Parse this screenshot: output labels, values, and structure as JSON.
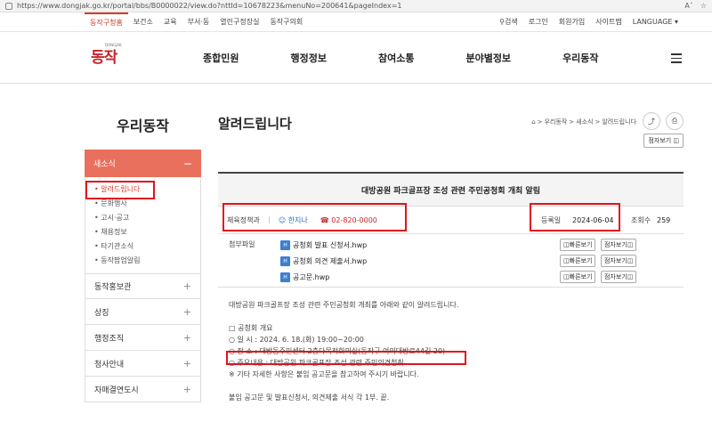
{
  "browser": {
    "url": "https://www.dongjak.go.kr/portal/bbs/B0000022/view.do?nttId=10678223&menuNo=200641&pageIndex=1",
    "read_label": "Aˆ",
    "star": "☆"
  },
  "util": {
    "topnav": [
      "동작구청홈",
      "보건소",
      "교육",
      "부서·동",
      "열린구정장실",
      "동작구의회"
    ],
    "right": [
      "검색",
      "로그인",
      "회원가입",
      "사이트맵",
      "LANGUAGE ▾"
    ]
  },
  "header": {
    "logo_text": "동작",
    "logo_small": "DONGJAK",
    "gnb": [
      "종합민원",
      "행정정보",
      "참여소통",
      "분야별정보",
      "우리동작"
    ]
  },
  "side": {
    "title": "우리동작",
    "current": "새소식",
    "current_icon": "−",
    "sub": [
      "알려드립니다",
      "문화행사",
      "고시·공고",
      "채용정보",
      "타기관소식",
      "동작팝업알림"
    ],
    "groups": [
      "동작홍보관",
      "상징",
      "행정조직",
      "청사안내",
      "자매결연도시"
    ],
    "plus": "+"
  },
  "content": {
    "title": "알려드립니다",
    "crumb": [
      "⌂",
      "우리동작",
      "새소식",
      "알려드립니다"
    ],
    "crumb_sep": ">",
    "share_icon": "⤴",
    "print_icon": "⎙",
    "viewer_label": "점자보기",
    "board": {
      "title": "대방공원 파크골프장 조성 관련 주민공청회 개최 알림",
      "dept": "체육정책과",
      "person": "☺ 한지나",
      "phone": "☎ 02-820-0000",
      "date_label": "등록일",
      "date": "2024-06-04",
      "views_label": "조회수",
      "views": "259",
      "files_label": "첨부파일",
      "files": [
        "공청회 발표 신청서.hwp",
        "공청회 의견 제출서.hwp",
        "공고문.hwp"
      ],
      "quick_label": "빠른보기",
      "braille_label": "점자보기",
      "file_icon": "H"
    },
    "body": [
      "대방공원 파크골프장 조성 관련 주민공청회 개최를 아래와 같이 알려드립니다.",
      "",
      "□ 공청회 개요",
      "○ 일 시 : 2024. 6. 18.(화) 19:00~20:00",
      "○ 장 소 : 대방동주민센터 2층다목적회의실(동작구 여의대방로44길 20)",
      "○ 주요내용 : 대방공원 파크골프장 조성 관련 주민의견청취",
      "※ 기타 자세한 사항은 붙임 공고문을 참고하여 주시기 바랍니다.",
      "",
      "붙임 공고문 및 발표신청서, 의견제출 서식 각 1부. 끝."
    ]
  },
  "colors": {
    "accent": "#e8705d",
    "brand_red": "#c8232c",
    "highlight": "#e0141e"
  }
}
